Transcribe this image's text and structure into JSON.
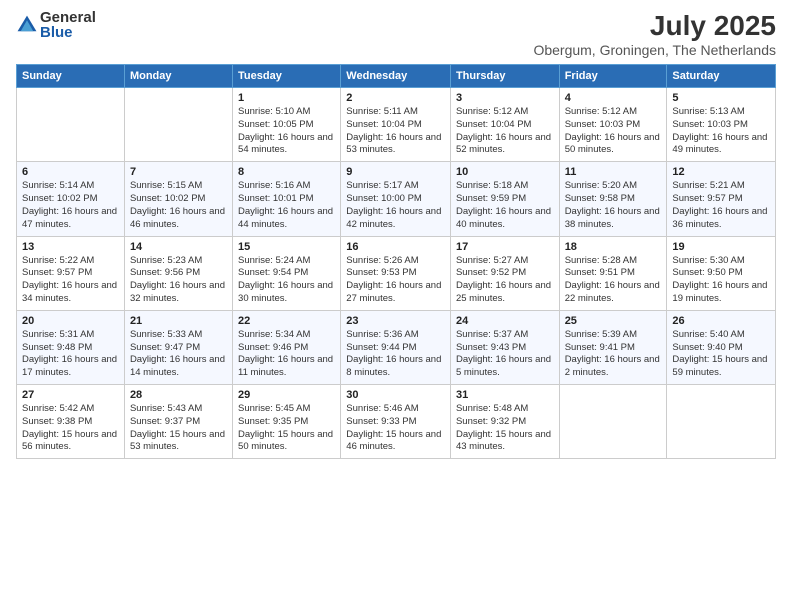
{
  "logo": {
    "general": "General",
    "blue": "Blue"
  },
  "header": {
    "month_year": "July 2025",
    "location": "Obergum, Groningen, The Netherlands"
  },
  "weekdays": [
    "Sunday",
    "Monday",
    "Tuesday",
    "Wednesday",
    "Thursday",
    "Friday",
    "Saturday"
  ],
  "weeks": [
    [
      {
        "day": "",
        "info": ""
      },
      {
        "day": "",
        "info": ""
      },
      {
        "day": "1",
        "info": "Sunrise: 5:10 AM\nSunset: 10:05 PM\nDaylight: 16 hours\nand 54 minutes."
      },
      {
        "day": "2",
        "info": "Sunrise: 5:11 AM\nSunset: 10:04 PM\nDaylight: 16 hours\nand 53 minutes."
      },
      {
        "day": "3",
        "info": "Sunrise: 5:12 AM\nSunset: 10:04 PM\nDaylight: 16 hours\nand 52 minutes."
      },
      {
        "day": "4",
        "info": "Sunrise: 5:12 AM\nSunset: 10:03 PM\nDaylight: 16 hours\nand 50 minutes."
      },
      {
        "day": "5",
        "info": "Sunrise: 5:13 AM\nSunset: 10:03 PM\nDaylight: 16 hours\nand 49 minutes."
      }
    ],
    [
      {
        "day": "6",
        "info": "Sunrise: 5:14 AM\nSunset: 10:02 PM\nDaylight: 16 hours\nand 47 minutes."
      },
      {
        "day": "7",
        "info": "Sunrise: 5:15 AM\nSunset: 10:02 PM\nDaylight: 16 hours\nand 46 minutes."
      },
      {
        "day": "8",
        "info": "Sunrise: 5:16 AM\nSunset: 10:01 PM\nDaylight: 16 hours\nand 44 minutes."
      },
      {
        "day": "9",
        "info": "Sunrise: 5:17 AM\nSunset: 10:00 PM\nDaylight: 16 hours\nand 42 minutes."
      },
      {
        "day": "10",
        "info": "Sunrise: 5:18 AM\nSunset: 9:59 PM\nDaylight: 16 hours\nand 40 minutes."
      },
      {
        "day": "11",
        "info": "Sunrise: 5:20 AM\nSunset: 9:58 PM\nDaylight: 16 hours\nand 38 minutes."
      },
      {
        "day": "12",
        "info": "Sunrise: 5:21 AM\nSunset: 9:57 PM\nDaylight: 16 hours\nand 36 minutes."
      }
    ],
    [
      {
        "day": "13",
        "info": "Sunrise: 5:22 AM\nSunset: 9:57 PM\nDaylight: 16 hours\nand 34 minutes."
      },
      {
        "day": "14",
        "info": "Sunrise: 5:23 AM\nSunset: 9:56 PM\nDaylight: 16 hours\nand 32 minutes."
      },
      {
        "day": "15",
        "info": "Sunrise: 5:24 AM\nSunset: 9:54 PM\nDaylight: 16 hours\nand 30 minutes."
      },
      {
        "day": "16",
        "info": "Sunrise: 5:26 AM\nSunset: 9:53 PM\nDaylight: 16 hours\nand 27 minutes."
      },
      {
        "day": "17",
        "info": "Sunrise: 5:27 AM\nSunset: 9:52 PM\nDaylight: 16 hours\nand 25 minutes."
      },
      {
        "day": "18",
        "info": "Sunrise: 5:28 AM\nSunset: 9:51 PM\nDaylight: 16 hours\nand 22 minutes."
      },
      {
        "day": "19",
        "info": "Sunrise: 5:30 AM\nSunset: 9:50 PM\nDaylight: 16 hours\nand 19 minutes."
      }
    ],
    [
      {
        "day": "20",
        "info": "Sunrise: 5:31 AM\nSunset: 9:48 PM\nDaylight: 16 hours\nand 17 minutes."
      },
      {
        "day": "21",
        "info": "Sunrise: 5:33 AM\nSunset: 9:47 PM\nDaylight: 16 hours\nand 14 minutes."
      },
      {
        "day": "22",
        "info": "Sunrise: 5:34 AM\nSunset: 9:46 PM\nDaylight: 16 hours\nand 11 minutes."
      },
      {
        "day": "23",
        "info": "Sunrise: 5:36 AM\nSunset: 9:44 PM\nDaylight: 16 hours\nand 8 minutes."
      },
      {
        "day": "24",
        "info": "Sunrise: 5:37 AM\nSunset: 9:43 PM\nDaylight: 16 hours\nand 5 minutes."
      },
      {
        "day": "25",
        "info": "Sunrise: 5:39 AM\nSunset: 9:41 PM\nDaylight: 16 hours\nand 2 minutes."
      },
      {
        "day": "26",
        "info": "Sunrise: 5:40 AM\nSunset: 9:40 PM\nDaylight: 15 hours\nand 59 minutes."
      }
    ],
    [
      {
        "day": "27",
        "info": "Sunrise: 5:42 AM\nSunset: 9:38 PM\nDaylight: 15 hours\nand 56 minutes."
      },
      {
        "day": "28",
        "info": "Sunrise: 5:43 AM\nSunset: 9:37 PM\nDaylight: 15 hours\nand 53 minutes."
      },
      {
        "day": "29",
        "info": "Sunrise: 5:45 AM\nSunset: 9:35 PM\nDaylight: 15 hours\nand 50 minutes."
      },
      {
        "day": "30",
        "info": "Sunrise: 5:46 AM\nSunset: 9:33 PM\nDaylight: 15 hours\nand 46 minutes."
      },
      {
        "day": "31",
        "info": "Sunrise: 5:48 AM\nSunset: 9:32 PM\nDaylight: 15 hours\nand 43 minutes."
      },
      {
        "day": "",
        "info": ""
      },
      {
        "day": "",
        "info": ""
      }
    ]
  ]
}
